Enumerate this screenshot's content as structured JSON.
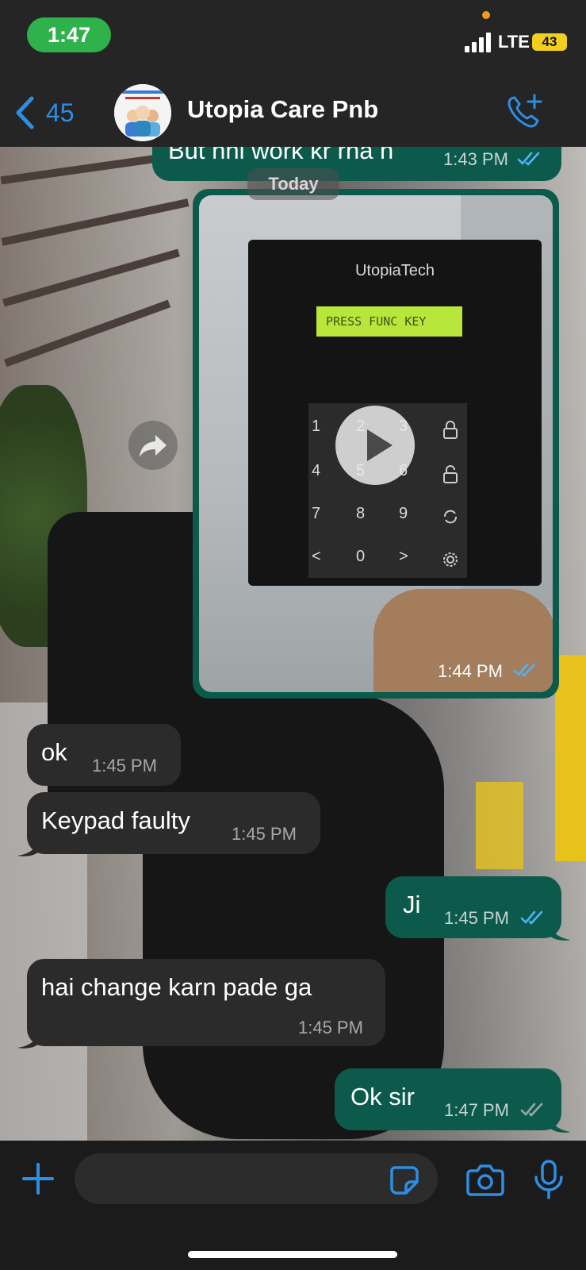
{
  "status_bar": {
    "time": "1:47",
    "network": "LTE",
    "battery": "43"
  },
  "header": {
    "back_count": "45",
    "chat_name": "Utopia Care Pnb"
  },
  "date_chip": "Today",
  "messages": [
    {
      "direction": "out",
      "text": "But nhi work kr rha h",
      "time": "1:43 PM",
      "status": "read"
    },
    {
      "direction": "out",
      "type": "video",
      "time": "1:44 PM",
      "status": "read",
      "video": {
        "brand": "UtopiaTech",
        "lcd": "PRESS FUNC KEY",
        "keys": [
          "1",
          "2",
          "3",
          "4",
          "5",
          "6",
          "7",
          "8",
          "9",
          "<",
          "0",
          ">"
        ]
      }
    },
    {
      "direction": "in",
      "text": "ok",
      "time": "1:45 PM"
    },
    {
      "direction": "in",
      "text": "Keypad faulty",
      "time": "1:45 PM"
    },
    {
      "direction": "out",
      "text": "Ji",
      "time": "1:45 PM",
      "status": "read"
    },
    {
      "direction": "in",
      "text": "hai change karn pade ga",
      "time": "1:45 PM"
    },
    {
      "direction": "out",
      "text": "Ok sir",
      "time": "1:47 PM",
      "status": "delivered"
    }
  ],
  "input": {
    "placeholder": ""
  },
  "colors": {
    "accent": "#2d8fe3",
    "outgoing": "#0b5a4b",
    "incoming": "#2b2b2b",
    "read_tick": "#4fb3f5",
    "delivered_tick": "#9aa7a4"
  }
}
